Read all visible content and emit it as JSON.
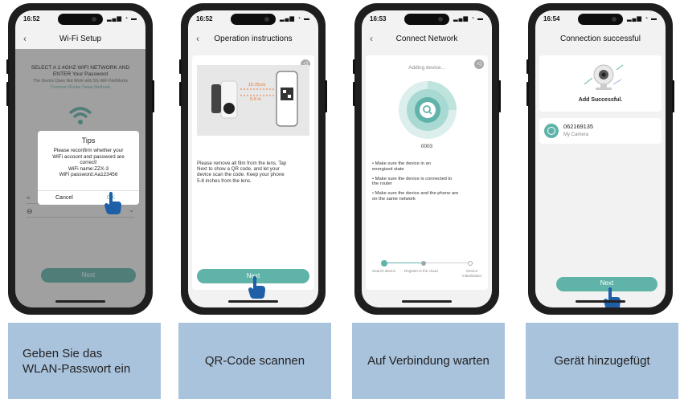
{
  "phones": [
    {
      "status_time": "16:52",
      "title": "Wi-Fi Setup",
      "header_line1": "SELECT A 2.4GHZ WIFI NETWORK AND",
      "header_line2": "ENTER Your Password",
      "warning": "The Device Does Not Work with 5G WiFi NetWorks",
      "link": "Common Router Setup Methods",
      "dialog": {
        "title": "Tips",
        "message_line1": "Please reconfirm whether your",
        "message_line2": "WiFi account and password are",
        "message_line3": "correct!",
        "wifi_name": "WiFi name:ZZX-3",
        "wifi_password": "WiFi password:Aa123456",
        "cancel": "Cancel",
        "ok": "OK"
      },
      "next": "Next"
    },
    {
      "status_time": "16:52",
      "title": "Operation instructions",
      "distance_1": "15-25cm",
      "distance_2": "5-8 in",
      "instructions_line1": "Please remove all film from the lens. Tap",
      "instructions_line2": "Next to show a QR code, and let your",
      "instructions_line3": "device scan the code. Keep your phone",
      "instructions_line4": "5-8 inches from the lens.",
      "next": "Next"
    },
    {
      "status_time": "16:53",
      "title": "Connect Network",
      "adding": "Adding device...",
      "counter": "0003",
      "bullet1_line1": "• Make sure the device in an",
      "bullet1_line2": "energized state",
      "bullet2_line1": "• Make sure the device is connected to",
      "bullet2_line2": "the router",
      "bullet3_line1": "• Make sure the device and the phone are",
      "bullet3_line2": "on the same network",
      "step1": "Search device",
      "step2": "Register is the cloud",
      "step3_line1": "Device",
      "step3_line2": "initialization"
    },
    {
      "status_time": "16:54",
      "title": "Connection successful",
      "success": "Add Successful.",
      "device_id": "062169135",
      "device_name": "My Camera",
      "next": "Next"
    }
  ],
  "captions": [
    {
      "line1": "Geben Sie das",
      "line2": "WLAN-Passwort ein"
    },
    {
      "line1": "QR-Code scannen"
    },
    {
      "line1": "Auf Verbindung warten"
    },
    {
      "line1": "Gerät hinzugefügt"
    }
  ],
  "colors": {
    "accent": "#5fb3a8",
    "caption_bg": "#aac3dd",
    "phone_frame": "#1e1e1e"
  }
}
